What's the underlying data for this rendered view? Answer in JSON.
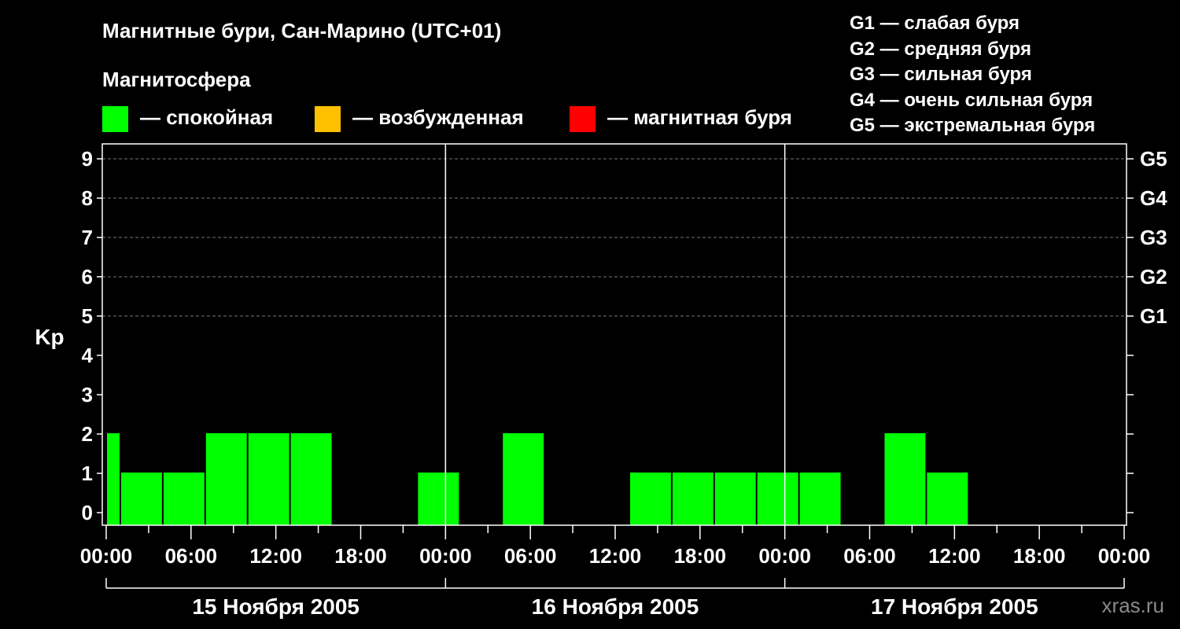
{
  "header": {
    "title": "Магнитные бури, Сан-Марино (UTC+01)",
    "subtitle": "Магнитосфера"
  },
  "legend": [
    {
      "label": "— спокойная",
      "color": "#00ff00"
    },
    {
      "label": "— возбужденная",
      "color": "#ffc000"
    },
    {
      "label": "— магнитная буря",
      "color": "#ff0000"
    }
  ],
  "storm_levels": [
    "G1 — слабая буря",
    "G2 — средняя буря",
    "G3 — сильная буря",
    "G4 — очень сильная буря",
    "G5 — экстремальная буря"
  ],
  "watermark": "xras.ru",
  "chart_data": {
    "type": "bar",
    "ylabel": "Kp",
    "ylim": [
      0,
      9
    ],
    "yticks": [
      "0",
      "1",
      "2",
      "3",
      "4",
      "5",
      "6",
      "7",
      "8",
      "9"
    ],
    "right_ticks": [
      {
        "value": 5,
        "label": "G1"
      },
      {
        "value": 6,
        "label": "G2"
      },
      {
        "value": 7,
        "label": "G3"
      },
      {
        "value": 8,
        "label": "G4"
      },
      {
        "value": 9,
        "label": "G5"
      }
    ],
    "xlim_hours": [
      0,
      72
    ],
    "xtick_labels": [
      "00:00",
      "06:00",
      "12:00",
      "18:00",
      "00:00",
      "06:00",
      "12:00",
      "18:00",
      "00:00",
      "06:00",
      "12:00",
      "18:00",
      "00:00"
    ],
    "days": [
      "15 Ноября 2005",
      "16 Ноября 2005",
      "17 Ноября 2005"
    ],
    "grid": true,
    "bar_color": "#00ff00",
    "bars": [
      {
        "start": "15 Ноября 2005 00:00",
        "end": "15 Ноября 2005 01:00",
        "kp": 2
      },
      {
        "start": "15 Ноября 2005 01:00",
        "end": "15 Ноября 2005 04:00",
        "kp": 1
      },
      {
        "start": "15 Ноября 2005 04:00",
        "end": "15 Ноября 2005 07:00",
        "kp": 1
      },
      {
        "start": "15 Ноября 2005 07:00",
        "end": "15 Ноября 2005 10:00",
        "kp": 2
      },
      {
        "start": "15 Ноября 2005 10:00",
        "end": "15 Ноября 2005 13:00",
        "kp": 2
      },
      {
        "start": "15 Ноября 2005 13:00",
        "end": "15 Ноября 2005 16:00",
        "kp": 2
      },
      {
        "start": "15 Ноября 2005 22:00",
        "end": "16 Ноября 2005 01:00",
        "kp": 1
      },
      {
        "start": "16 Ноября 2005 04:00",
        "end": "16 Ноября 2005 07:00",
        "kp": 2
      },
      {
        "start": "16 Ноября 2005 13:00",
        "end": "16 Ноября 2005 16:00",
        "kp": 1
      },
      {
        "start": "16 Ноября 2005 16:00",
        "end": "16 Ноября 2005 19:00",
        "kp": 1
      },
      {
        "start": "16 Ноября 2005 19:00",
        "end": "16 Ноября 2005 22:00",
        "kp": 1
      },
      {
        "start": "16 Ноября 2005 22:00",
        "end": "17 Ноября 2005 01:00",
        "kp": 1
      },
      {
        "start": "17 Ноября 2005 01:00",
        "end": "17 Ноября 2005 04:00",
        "kp": 1
      },
      {
        "start": "17 Ноября 2005 07:00",
        "end": "17 Ноября 2005 10:00",
        "kp": 2
      },
      {
        "start": "17 Ноября 2005 10:00",
        "end": "17 Ноября 2005 13:00",
        "kp": 1
      }
    ]
  }
}
